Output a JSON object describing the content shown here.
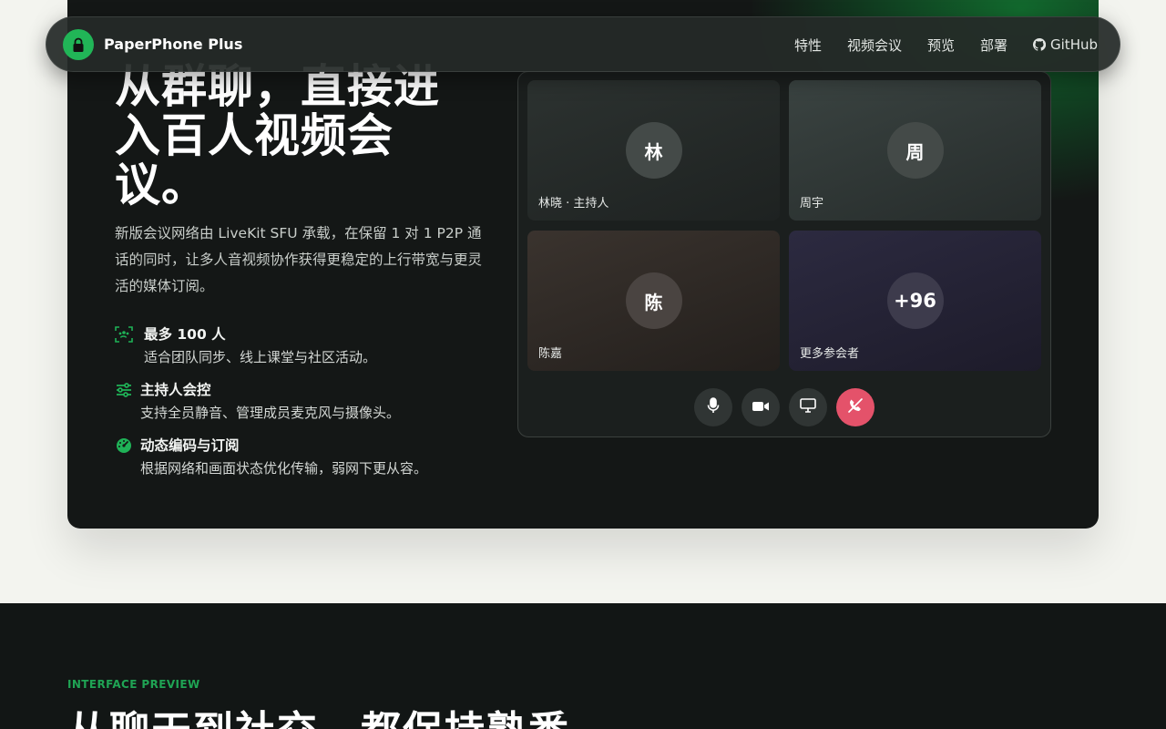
{
  "nav": {
    "brand": "PaperPhone Plus",
    "links": [
      "特性",
      "视频会议",
      "预览",
      "部署"
    ],
    "github_label": "GitHub"
  },
  "hero": {
    "title": "从群聊，直接进入百人视频会议。",
    "description": "新版会议网络由 LiveKit SFU 承载，在保留 1 对 1 P2P 通话的同时，让多人音视频协作获得更稳定的上行带宽与更灵活的媒体订阅。",
    "features": [
      {
        "icon": "users-scan-icon",
        "title": "最多 100 人",
        "desc": "适合团队同步、线上课堂与社区活动。"
      },
      {
        "icon": "sliders-icon",
        "title": "主持人会控",
        "desc": "支持全员静音、管理成员麦克风与摄像头。"
      },
      {
        "icon": "gauge-icon",
        "title": "动态编码与订阅",
        "desc": "根据网络和画面状态优化传输，弱网下更从容。"
      }
    ]
  },
  "meeting": {
    "tiles": [
      {
        "avatar": "林",
        "name": "林晓 · 主持人"
      },
      {
        "avatar": "周",
        "name": "周宇"
      },
      {
        "avatar": "陈",
        "name": "陈嘉"
      },
      {
        "avatar": "+96",
        "name": "更多参会者"
      }
    ],
    "controls": [
      "microphone-icon",
      "camera-icon",
      "screen-share-icon",
      "hang-up-icon"
    ]
  },
  "preview": {
    "eyebrow": "INTERFACE PREVIEW",
    "title": "从聊天到社交，都保持熟悉"
  },
  "colors": {
    "accent": "#21b557",
    "hangup": "#e4526a",
    "dark": "#141716"
  }
}
